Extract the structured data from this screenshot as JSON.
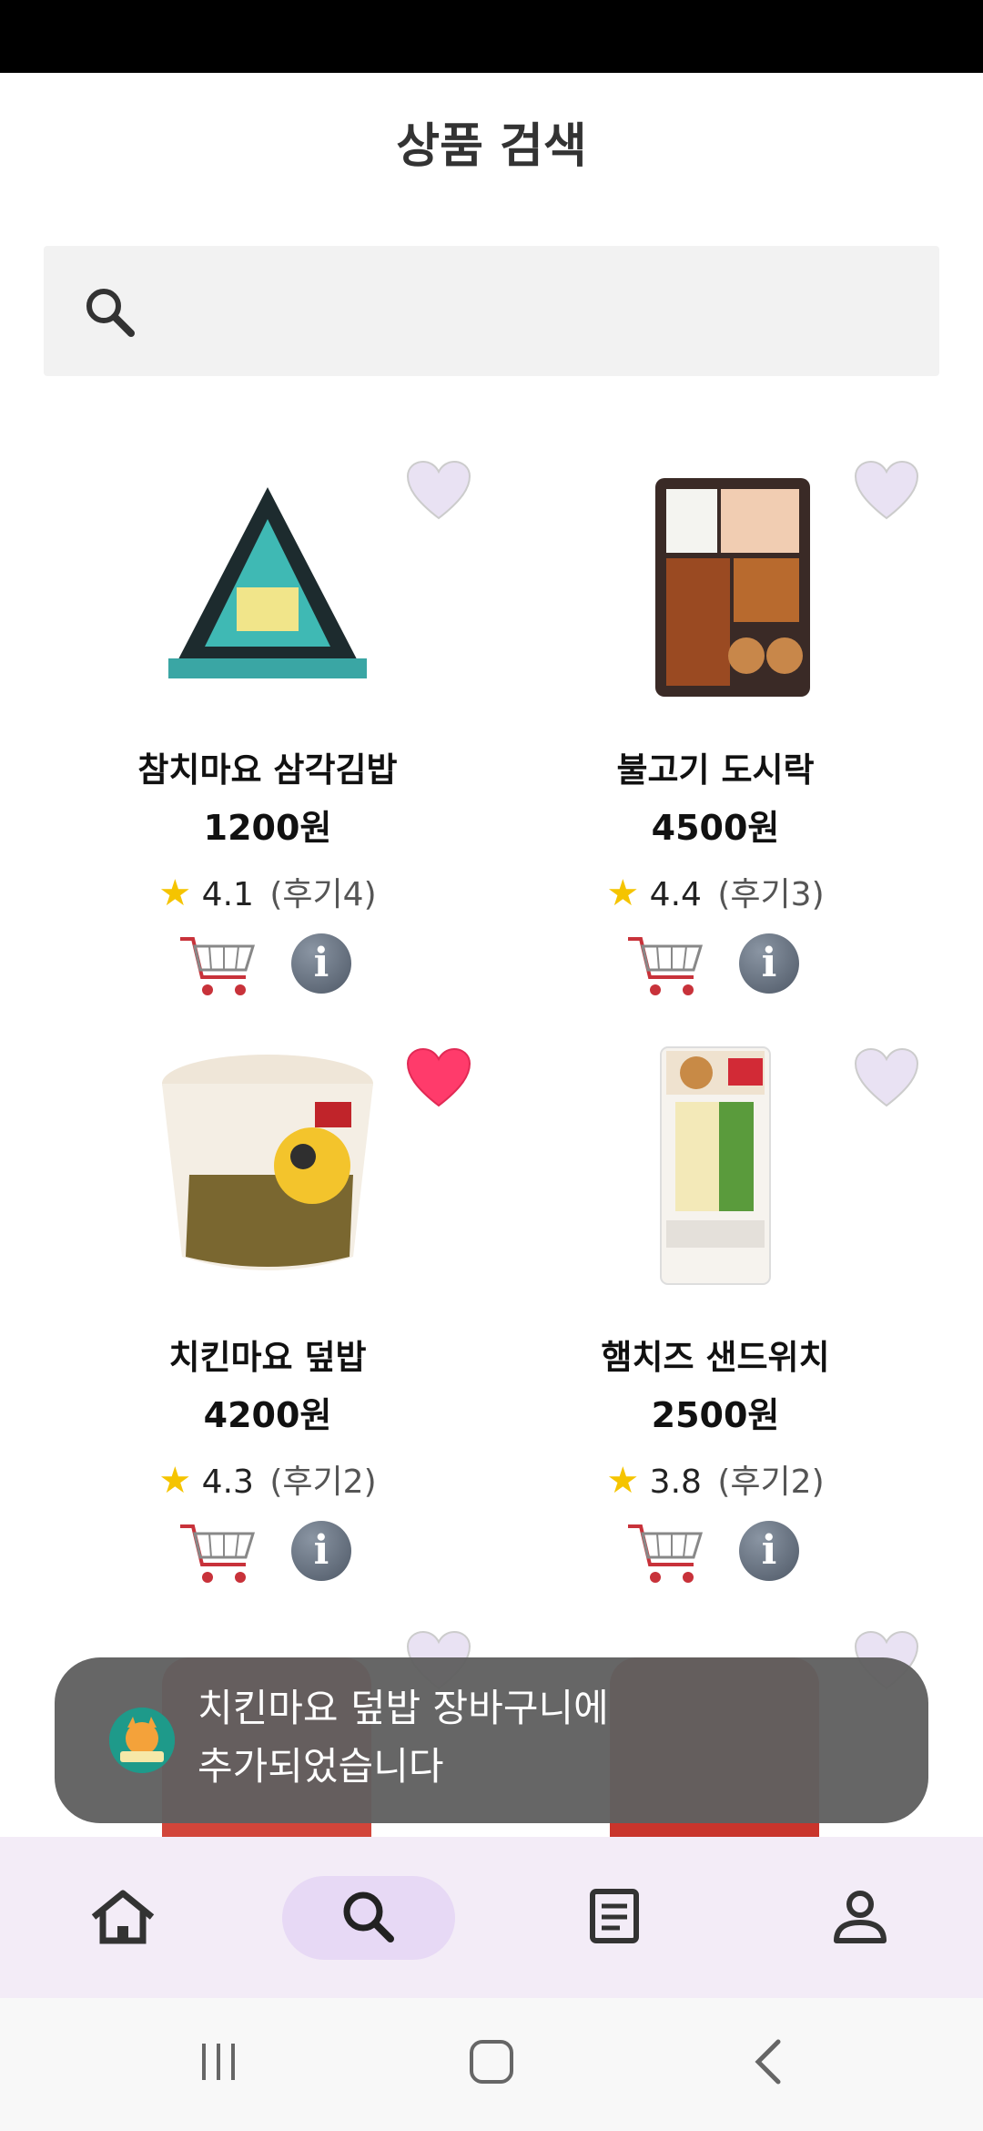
{
  "page": {
    "title": "상품 검색"
  },
  "search": {
    "placeholder": "",
    "value": ""
  },
  "products": [
    {
      "name": "참치마요 삼각김밥",
      "price": "1200원",
      "rating": "4.1",
      "reviews": "(후기4)",
      "favorite": false
    },
    {
      "name": "불고기 도시락",
      "price": "4500원",
      "rating": "4.4",
      "reviews": "(후기3)",
      "favorite": false
    },
    {
      "name": "치킨마요 덮밥",
      "price": "4200원",
      "rating": "4.3",
      "reviews": "(후기2)",
      "favorite": true
    },
    {
      "name": "햄치즈 샌드위치",
      "price": "2500원",
      "rating": "3.8",
      "reviews": "(후기2)",
      "favorite": false
    }
  ],
  "toast": {
    "line1": "치킨마요 덮밥 장바구니에",
    "line2": "추가되었습니다"
  },
  "bottom_nav": {
    "items": [
      {
        "icon": "home-icon",
        "active": false
      },
      {
        "icon": "search-icon",
        "active": true
      },
      {
        "icon": "list-icon",
        "active": false
      },
      {
        "icon": "profile-icon",
        "active": false
      }
    ]
  },
  "colors": {
    "heart_active": "#ff3b6b",
    "heart_inactive": "#e9e2f3",
    "nav_bg": "#f3ecf7",
    "nav_pill": "#e7d9f5",
    "star": "#f5c400"
  }
}
